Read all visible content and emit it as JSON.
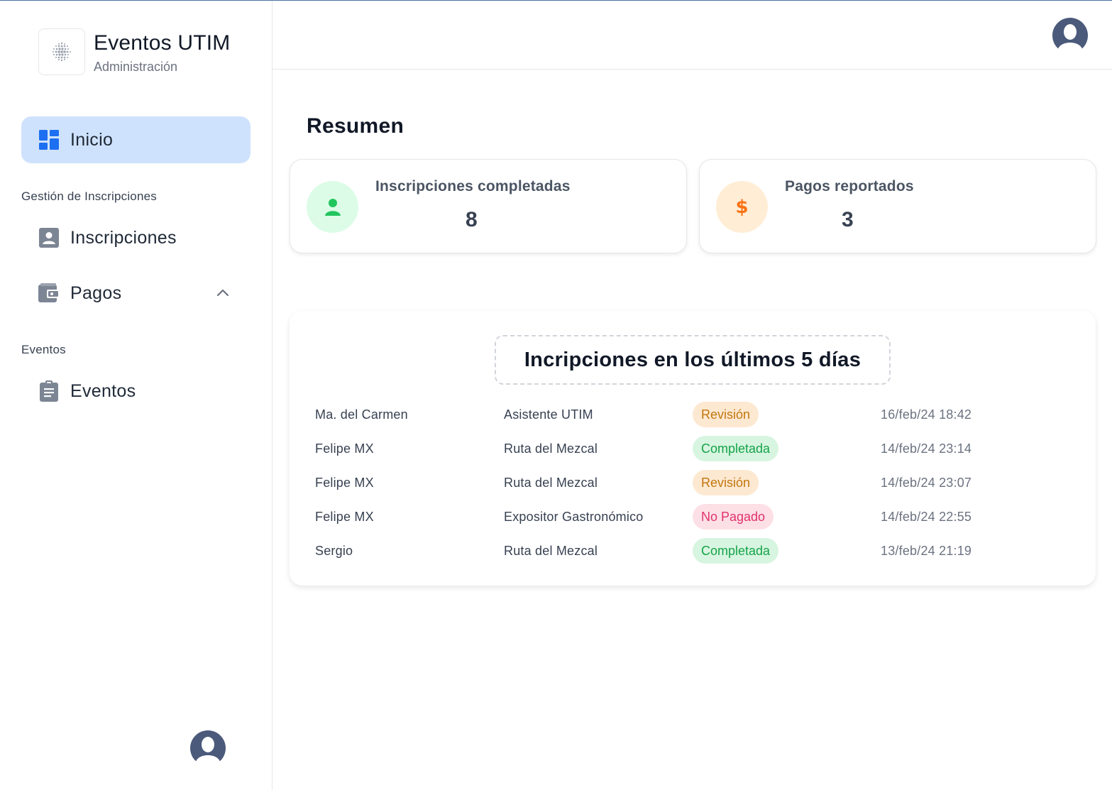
{
  "brand": {
    "title": "Eventos UTIM",
    "subtitle": "Administración"
  },
  "sidebar": {
    "items": [
      {
        "label": "Inicio",
        "icon": "dashboard-icon",
        "active": true
      },
      {
        "label": "Inscripciones",
        "icon": "user-card-icon"
      },
      {
        "label": "Pagos",
        "icon": "wallet-icon",
        "expanded": true
      },
      {
        "label": "Eventos",
        "icon": "clipboard-icon"
      }
    ],
    "sections": [
      "Gestión de Inscripciones",
      "Eventos"
    ]
  },
  "main": {
    "title": "Resumen",
    "stats": [
      {
        "label": "Inscripciones completadas",
        "value": "8",
        "icon": "user-icon",
        "color": "#22c55e",
        "bg": "#dcfce7"
      },
      {
        "label": "Pagos reportados",
        "value": "3",
        "icon": "dollar-icon",
        "color": "#f97316",
        "bg": "#ffedd5"
      }
    ],
    "recent": {
      "title": "Incripciones en los últimos 5 días",
      "rows": [
        {
          "name": "Ma. del Carmen",
          "event": "Asistente UTIM",
          "status": "Revisión",
          "date": "16/feb/24 18:42"
        },
        {
          "name": "Felipe MX",
          "event": "Ruta del Mezcal",
          "status": "Completada",
          "date": "14/feb/24 23:14"
        },
        {
          "name": "Felipe MX",
          "event": "Ruta del Mezcal",
          "status": "Revisión",
          "date": "14/feb/24 23:07"
        },
        {
          "name": "Felipe MX",
          "event": "Expositor Gastronómico",
          "status": "No Pagado",
          "date": "14/feb/24 22:55"
        },
        {
          "name": "Sergio",
          "event": "Ruta del Mezcal",
          "status": "Completada",
          "date": "13/feb/24 21:19"
        }
      ]
    }
  },
  "colors": {
    "accent": "#1d6ff2",
    "active_bg": "#cfe2fd",
    "avatar": "#4b5a7a"
  }
}
